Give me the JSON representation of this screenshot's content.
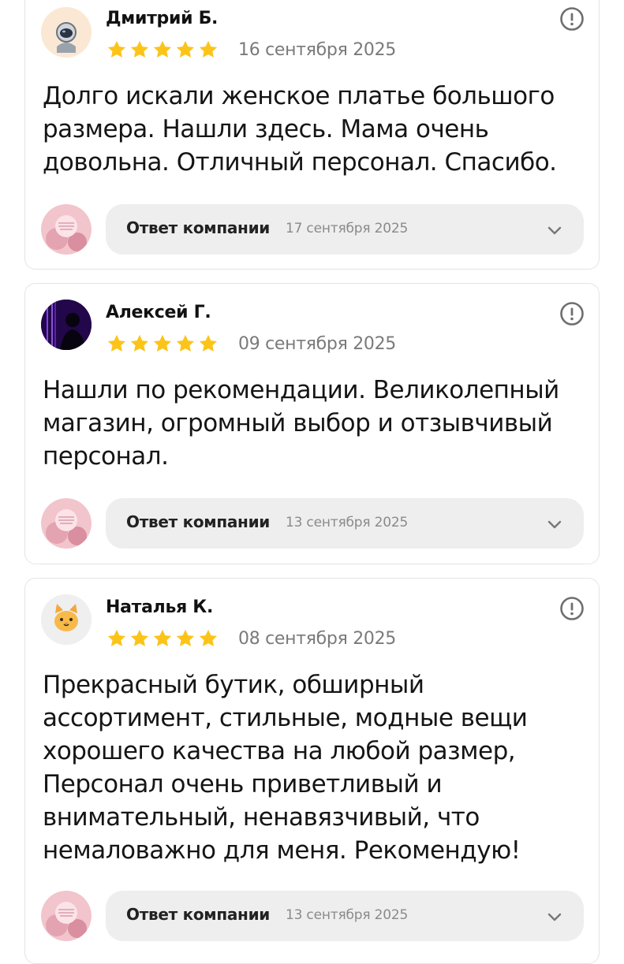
{
  "reviews": [
    {
      "author": "Дмитрий Б.",
      "rating": 5,
      "date": "16 сентября 2025",
      "text": "Долго искали женское платье большого размера. Нашли здесь. Мама очень довольна. Отличный персонал. Спасибо.",
      "avatar_icon": "astronaut-icon",
      "reply": {
        "label": "Ответ компании",
        "date": "17 сентября 2025"
      }
    },
    {
      "author": "Алексей Г.",
      "rating": 5,
      "date": "09 сентября 2025",
      "text": "Нашли по рекомендации. Великолепный магазин, огромный выбор и отзывчивый персонал.",
      "avatar_icon": "silhouette-photo-icon",
      "reply": {
        "label": "Ответ компании",
        "date": "13 сентября 2025"
      }
    },
    {
      "author": "Наталья К.",
      "rating": 5,
      "date": "08 сентября 2025",
      "text": "Прекрасный бутик, обширный ассортимент, стильные, модные вещи хорошего качества на любой размер, Персонал очень приветливый и внимательный, ненавязчивый, что немаловажно для меня. Рекомендую!",
      "avatar_icon": "cat-face-icon",
      "reply": {
        "label": "Ответ компании",
        "date": "13 сентября 2025"
      }
    }
  ],
  "colors": {
    "star": "#fcc419",
    "text": "#151515",
    "muted": "#7a7a7a",
    "reply_bg": "#eeeeef",
    "card_border": "#e4e4e4"
  },
  "icons": {
    "complain": "exclamation-circle-icon",
    "expand": "chevron-down-icon",
    "star": "star-icon",
    "company_logo": "company-logo-icon"
  }
}
